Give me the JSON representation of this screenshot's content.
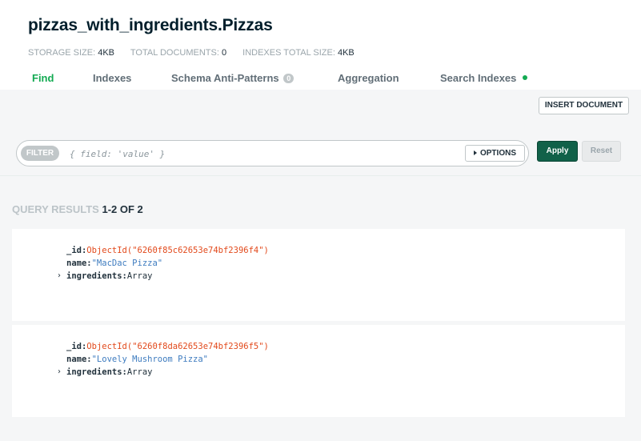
{
  "header": {
    "title": "pizzas_with_ingredients.Pizzas",
    "stats": [
      {
        "label": "STORAGE SIZE:",
        "value": "4KB"
      },
      {
        "label": "TOTAL DOCUMENTS:",
        "value": "0"
      },
      {
        "label": "INDEXES TOTAL SIZE:",
        "value": "4KB"
      }
    ]
  },
  "tabs": [
    {
      "label": "Find",
      "active": true
    },
    {
      "label": "Indexes"
    },
    {
      "label": "Schema Anti-Patterns",
      "badge": "0"
    },
    {
      "label": "Aggregation"
    },
    {
      "label": "Search Indexes",
      "status_dot": "green"
    }
  ],
  "toolbar": {
    "insert_label": "INSERT DOCUMENT"
  },
  "filter": {
    "label": "FILTER",
    "placeholder": "{ field: 'value' }",
    "value": "",
    "options_label": "OPTIONS",
    "apply_label": "Apply",
    "reset_label": "Reset"
  },
  "results": {
    "label": "QUERY RESULTS",
    "count": "1-2 OF 2"
  },
  "documents": [
    {
      "id_key": "_id:",
      "id_value": "ObjectId(\"6260f85c62653e74bf2396f4\")",
      "name_key": "name:",
      "name_value": "\"MacDac Pizza\"",
      "ingredients_key": "ingredients:",
      "ingredients_value": "Array"
    },
    {
      "id_key": "_id:",
      "id_value": "ObjectId(\"6260f8da62653e74bf2396f5\")",
      "name_key": "name:",
      "name_value": "\"Lovely Mushroom Pizza\"",
      "ingredients_key": "ingredients:",
      "ingredients_value": "Array"
    }
  ],
  "colors": {
    "accent_green": "#13aa52",
    "apply_green": "#116149",
    "objectid_red": "#e2491b",
    "string_blue": "#3d7bbf"
  },
  "icons": {
    "expand": "chevron-right-icon",
    "options_caret": "caret-right-icon",
    "search_indexes_status": "status-dot-icon"
  }
}
